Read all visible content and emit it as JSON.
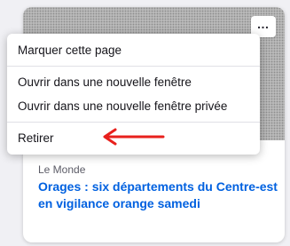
{
  "card": {
    "source": "Le Monde",
    "headline": "Orages : six départements du Centre-est en vigilance orange samedi",
    "more_button_label": "…"
  },
  "context_menu": {
    "items": [
      {
        "label": "Marquer cette page"
      },
      {
        "label": "Ouvrir dans une nouvelle fenêtre"
      },
      {
        "label": "Ouvrir dans une nouvelle fenêtre privée"
      },
      {
        "label": "Retirer"
      }
    ]
  },
  "annotation": {
    "arrow_color": "#e8201c",
    "arrow_icon": "red-arrow-left-icon"
  },
  "colors": {
    "link": "#0061e0",
    "source_text": "#5b5b66",
    "menu_text": "#15141a"
  }
}
